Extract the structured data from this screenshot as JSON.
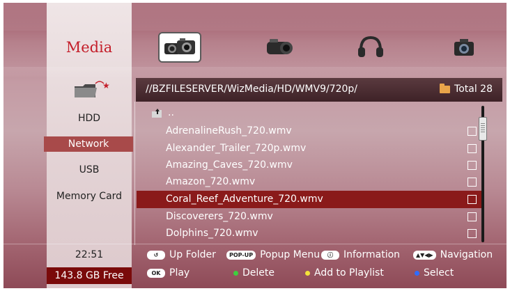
{
  "header": {
    "section_title": "Media",
    "tabs": [
      {
        "icon": "photo-video-camera-icon",
        "active": true
      },
      {
        "icon": "camcorder-icon",
        "active": false
      },
      {
        "icon": "headphones-icon",
        "active": false
      },
      {
        "icon": "camera-icon",
        "active": false
      }
    ]
  },
  "path_bar": {
    "path": "//BZFILESERVER/WizMedia/HD/WMV9/720p/",
    "total": "Total 28"
  },
  "sources": [
    {
      "label": "HDD",
      "selected": false
    },
    {
      "label": "Network",
      "selected": true
    },
    {
      "label": "USB",
      "selected": false
    },
    {
      "label": "Memory Card",
      "selected": false
    }
  ],
  "up_folder_label": "..",
  "files": [
    {
      "name": "AdrenalineRush_720.wmv",
      "selected": false
    },
    {
      "name": "Alexander_Trailer_720p.wmv",
      "selected": false
    },
    {
      "name": "Amazing_Caves_720.wmv",
      "selected": false
    },
    {
      "name": "Amazon_720.wmv",
      "selected": false
    },
    {
      "name": "Coral_Reef_Adventure_720.wmv",
      "selected": true
    },
    {
      "name": "Discoverers_720.wmv",
      "selected": false
    },
    {
      "name": "Dolphins_720.wmv",
      "selected": false
    }
  ],
  "status": {
    "time": "22:51",
    "free_space": "143.8 GB Free"
  },
  "hints": {
    "up_folder": "Up Folder",
    "popup_key": "POP-UP",
    "popup_menu": "Popup Menu",
    "information": "Information",
    "navigation": "Navigation",
    "ok_key": "OK",
    "play": "Play",
    "delete": "Delete",
    "add_to_playlist": "Add to Playlist",
    "select": "Select"
  },
  "colors": {
    "accent_red": "#c41e2a",
    "selection": "#8a1a1a",
    "green_key": "#3ecf3e",
    "yellow_key": "#f3e23a",
    "blue_key": "#2f6cff"
  }
}
